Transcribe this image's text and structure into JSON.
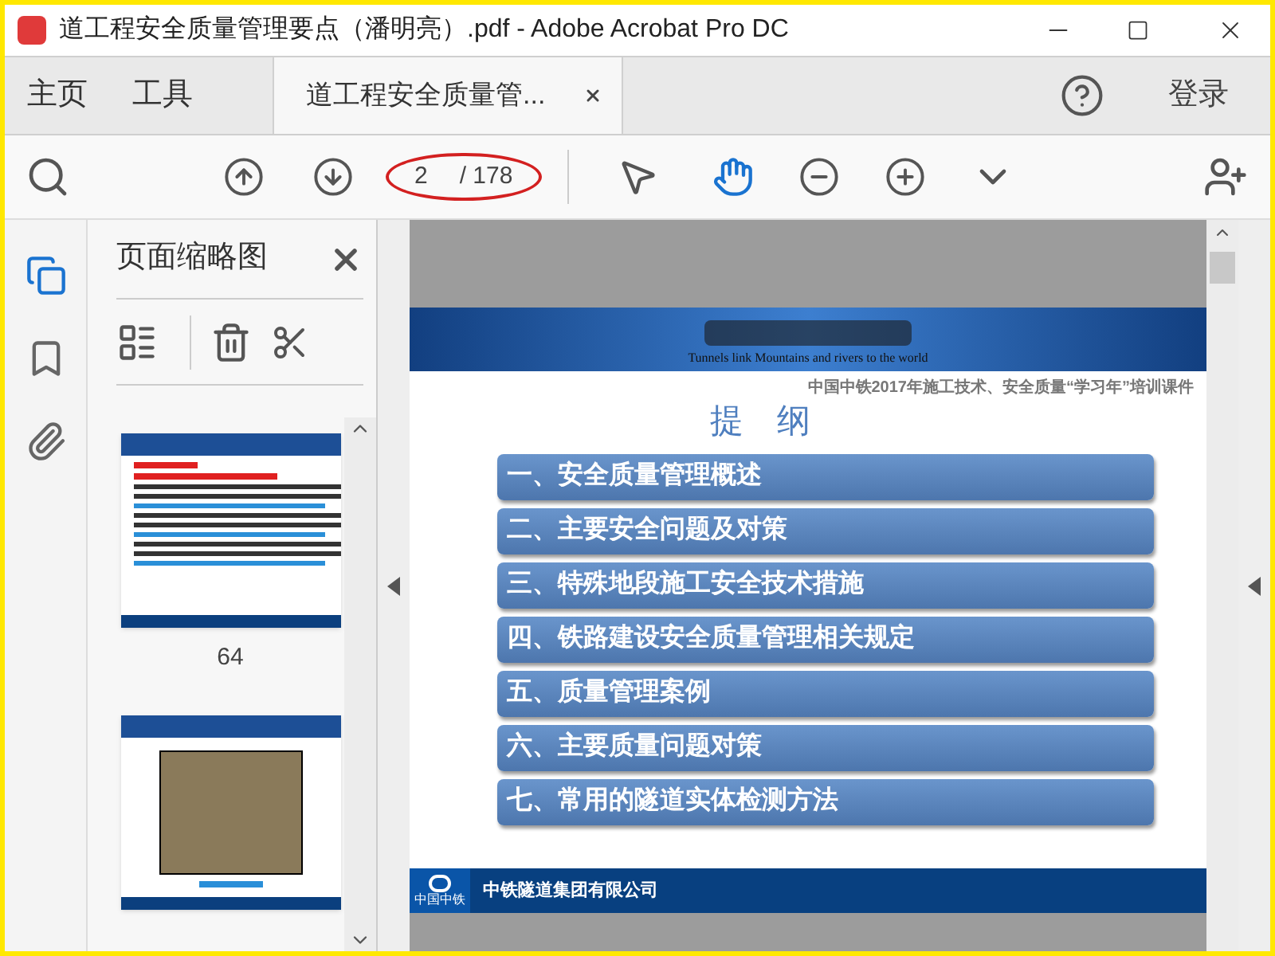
{
  "window": {
    "title": "道工程安全质量管理要点（潘明亮）.pdf - Adobe Acrobat Pro DC"
  },
  "nav_tabs": [
    {
      "label": "主页",
      "selected": false
    },
    {
      "label": "工具",
      "selected": false
    },
    {
      "label": "道工程安全质量管...",
      "selected": true,
      "closable": true
    }
  ],
  "header_actions": {
    "sign_in": "登录"
  },
  "toolbar": {
    "page_input": "2",
    "page_total": "/ 178",
    "tools": [
      {
        "kind": "select",
        "selected": false
      },
      {
        "kind": "hand",
        "selected": true
      }
    ]
  },
  "side_rail": [
    {
      "kind": "pages",
      "selected": true
    },
    {
      "kind": "bookmarks",
      "selected": false
    },
    {
      "kind": "attachments",
      "selected": false
    }
  ],
  "thumbnail_panel": {
    "title": "页面缩略图",
    "thumbnails": [
      {
        "kind": "text",
        "label": "64"
      },
      {
        "kind": "photo"
      }
    ]
  },
  "slide": {
    "tagline": "Tunnels link Mountains and rivers to the world",
    "subtitle": "中国中铁2017年施工技术、安全质量“学习年”培训课件",
    "heading": "提　纲",
    "items": [
      "一、安全质量管理概述",
      "二、主要安全问题及对策",
      "三、特殊地段施工安全技术措施",
      "四、铁路建设安全质量管理相关规定",
      "五、质量管理案例",
      "六、主要质量问题对策",
      "七、常用的隧道实体检测方法"
    ],
    "footer": "中铁隧道集团有限公司",
    "logo_caption": "中国中铁"
  }
}
